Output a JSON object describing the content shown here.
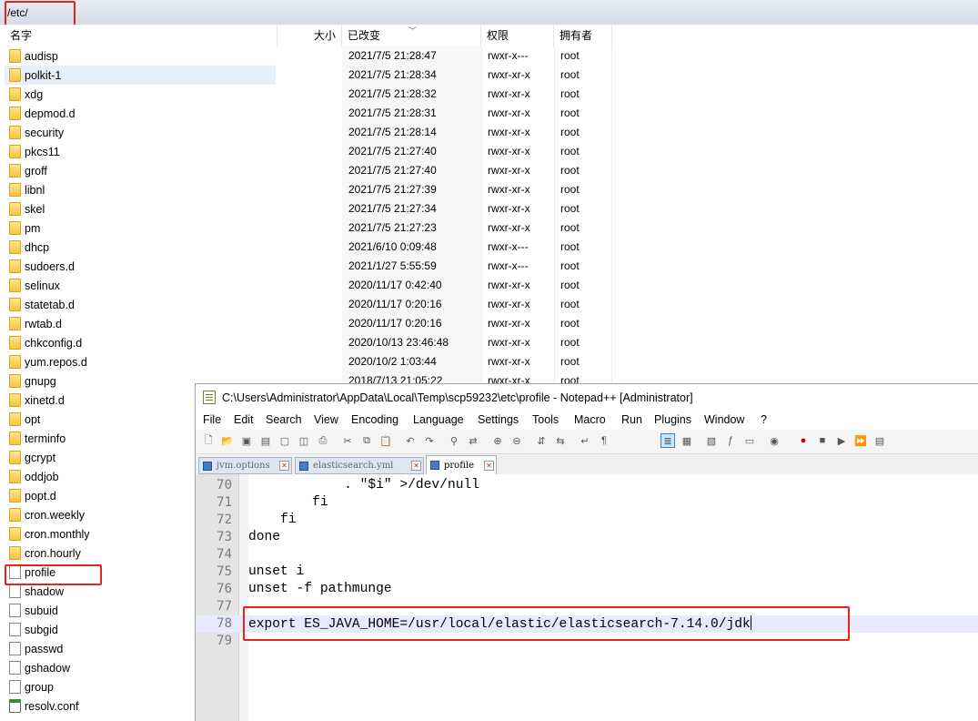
{
  "browser": {
    "path": "/etc/",
    "columns": {
      "name": "名字",
      "size": "大小",
      "modified": "已改变",
      "permissions": "权限",
      "owner": "拥有者"
    },
    "rows": [
      {
        "name": "audisp",
        "type": "folder",
        "modified": "2021/7/5 21:28:47",
        "perm": "rwxr-x---",
        "owner": "root"
      },
      {
        "name": "polkit-1",
        "type": "folder",
        "modified": "2021/7/5 21:28:34",
        "perm": "rwxr-xr-x",
        "owner": "root"
      },
      {
        "name": "xdg",
        "type": "folder",
        "modified": "2021/7/5 21:28:32",
        "perm": "rwxr-xr-x",
        "owner": "root"
      },
      {
        "name": "depmod.d",
        "type": "folder",
        "modified": "2021/7/5 21:28:31",
        "perm": "rwxr-xr-x",
        "owner": "root"
      },
      {
        "name": "security",
        "type": "folder",
        "modified": "2021/7/5 21:28:14",
        "perm": "rwxr-xr-x",
        "owner": "root"
      },
      {
        "name": "pkcs11",
        "type": "folder",
        "modified": "2021/7/5 21:27:40",
        "perm": "rwxr-xr-x",
        "owner": "root"
      },
      {
        "name": "groff",
        "type": "folder",
        "modified": "2021/7/5 21:27:40",
        "perm": "rwxr-xr-x",
        "owner": "root"
      },
      {
        "name": "libnl",
        "type": "folder",
        "modified": "2021/7/5 21:27:39",
        "perm": "rwxr-xr-x",
        "owner": "root"
      },
      {
        "name": "skel",
        "type": "folder",
        "modified": "2021/7/5 21:27:34",
        "perm": "rwxr-xr-x",
        "owner": "root"
      },
      {
        "name": "pm",
        "type": "folder",
        "modified": "2021/7/5 21:27:23",
        "perm": "rwxr-xr-x",
        "owner": "root"
      },
      {
        "name": "dhcp",
        "type": "folder",
        "modified": "2021/6/10 0:09:48",
        "perm": "rwxr-x---",
        "owner": "root"
      },
      {
        "name": "sudoers.d",
        "type": "folder",
        "modified": "2021/1/27 5:55:59",
        "perm": "rwxr-x---",
        "owner": "root"
      },
      {
        "name": "selinux",
        "type": "folder",
        "modified": "2020/11/17 0:42:40",
        "perm": "rwxr-xr-x",
        "owner": "root"
      },
      {
        "name": "statetab.d",
        "type": "folder",
        "modified": "2020/11/17 0:20:16",
        "perm": "rwxr-xr-x",
        "owner": "root"
      },
      {
        "name": "rwtab.d",
        "type": "folder",
        "modified": "2020/11/17 0:20:16",
        "perm": "rwxr-xr-x",
        "owner": "root"
      },
      {
        "name": "chkconfig.d",
        "type": "folder",
        "modified": "2020/10/13 23:46:48",
        "perm": "rwxr-xr-x",
        "owner": "root"
      },
      {
        "name": "yum.repos.d",
        "type": "folder",
        "modified": "2020/10/2 1:03:44",
        "perm": "rwxr-xr-x",
        "owner": "root"
      },
      {
        "name": "gnupg",
        "type": "folder",
        "modified": "2018/7/13 21:05:22",
        "perm": "rwxr-xr-x",
        "owner": "root"
      },
      {
        "name": "xinetd.d",
        "type": "folder",
        "modified": "",
        "perm": "",
        "owner": ""
      },
      {
        "name": "opt",
        "type": "folder",
        "modified": "",
        "perm": "",
        "owner": ""
      },
      {
        "name": "terminfo",
        "type": "folder",
        "modified": "",
        "perm": "",
        "owner": ""
      },
      {
        "name": "gcrypt",
        "type": "folder",
        "modified": "",
        "perm": "",
        "owner": ""
      },
      {
        "name": "oddjob",
        "type": "folder",
        "modified": "",
        "perm": "",
        "owner": ""
      },
      {
        "name": "popt.d",
        "type": "folder",
        "modified": "",
        "perm": "",
        "owner": ""
      },
      {
        "name": "cron.weekly",
        "type": "folder",
        "modified": "",
        "perm": "",
        "owner": ""
      },
      {
        "name": "cron.monthly",
        "type": "folder",
        "modified": "",
        "perm": "",
        "owner": ""
      },
      {
        "name": "cron.hourly",
        "type": "folder",
        "modified": "",
        "perm": "",
        "owner": ""
      },
      {
        "name": "profile",
        "type": "file",
        "modified": "",
        "perm": "",
        "owner": ""
      },
      {
        "name": "shadow",
        "type": "file",
        "modified": "",
        "perm": "",
        "owner": ""
      },
      {
        "name": "subuid",
        "type": "file",
        "modified": "",
        "perm": "",
        "owner": ""
      },
      {
        "name": "subgid",
        "type": "file",
        "modified": "",
        "perm": "",
        "owner": ""
      },
      {
        "name": "passwd",
        "type": "file",
        "modified": "",
        "perm": "",
        "owner": ""
      },
      {
        "name": "gshadow",
        "type": "file",
        "modified": "",
        "perm": "",
        "owner": ""
      },
      {
        "name": "group",
        "type": "file",
        "modified": "",
        "perm": "",
        "owner": ""
      },
      {
        "name": "resolv.conf",
        "type": "conf",
        "modified": "",
        "perm": "",
        "owner": ""
      }
    ]
  },
  "notepad": {
    "title": "C:\\Users\\Administrator\\AppData\\Local\\Temp\\scp59232\\etc\\profile - Notepad++ [Administrator]",
    "menu": [
      "File",
      "Edit",
      "Search",
      "View",
      "Encoding",
      "Language",
      "Settings",
      "Tools",
      "Macro",
      "Run",
      "Plugins",
      "Window",
      "?"
    ],
    "tabs": [
      {
        "label": "jvm.options",
        "active": false
      },
      {
        "label": "elasticsearch.yml",
        "active": false
      },
      {
        "label": "profile",
        "active": true
      }
    ],
    "lines": [
      {
        "n": "70",
        "text": "            . \"$i\" >/dev/null"
      },
      {
        "n": "71",
        "text": "        fi"
      },
      {
        "n": "72",
        "text": "    fi"
      },
      {
        "n": "73",
        "text": "done"
      },
      {
        "n": "74",
        "text": ""
      },
      {
        "n": "75",
        "text": "unset i"
      },
      {
        "n": "76",
        "text": "unset -f pathmunge"
      },
      {
        "n": "77",
        "text": ""
      },
      {
        "n": "78",
        "text": "export ES_JAVA_HOME=/usr/local/elastic/elasticsearch-7.14.0/jdk"
      },
      {
        "n": "79",
        "text": ""
      }
    ]
  },
  "colors": {
    "highlight_box": "#e8231a",
    "selection": "#e5f0fb",
    "current_line": "#e8e8ff"
  }
}
